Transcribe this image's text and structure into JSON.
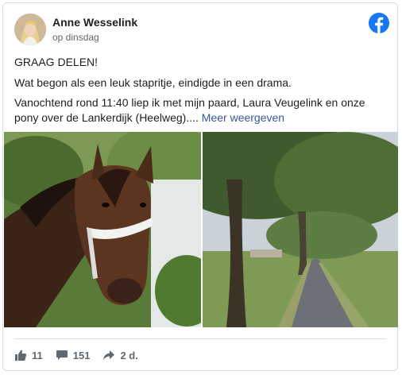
{
  "post": {
    "author": "Anne Wesselink",
    "timestamp": "op dinsdag",
    "headline": "GRAAG DELEN!",
    "line2": "Wat begon als een leuk stapritje, eindigde in een drama.",
    "line3": "Vanochtend rond 11:40 liep ik met mijn paard, Laura Veugelink en onze",
    "line4": "pony over de Lankerdijk (Heelweg)....",
    "more_link": "Meer weergeven"
  },
  "stats": {
    "likes": "11",
    "comments": "151",
    "shares": "2 d."
  },
  "icons": {
    "brand": "facebook-icon",
    "like": "thumbs-up-icon",
    "comment": "comment-icon",
    "share": "share-icon"
  },
  "colors": {
    "facebook_blue": "#1877f2",
    "link": "#385898",
    "text": "#1c1e21",
    "muted": "#606770"
  }
}
